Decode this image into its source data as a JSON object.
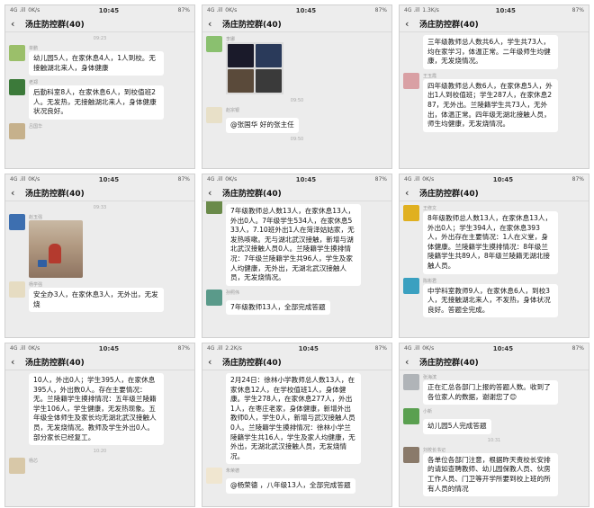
{
  "app": {
    "group_title": "汤庄防控群(40)"
  },
  "panels": [
    {
      "status": {
        "signal": "4G .ill",
        "speed": "0K/s",
        "time": "10:45",
        "battery": "87%"
      },
      "items": [
        {
          "kind": "ts",
          "text": "09:23"
        },
        {
          "kind": "msg",
          "sender": "单鹏",
          "avatar": "#9bbf6a",
          "text": "幼儿园5人，在家休息4人，1人到校。无接触湖北来人，身体健康"
        },
        {
          "kind": "msg",
          "sender": "老郑",
          "avatar": "#3c7a3a",
          "text": "后勤科室8人，在家休息6人，到校值班2人。无发热，无接触湖北来人，身体健康状况良好。"
        },
        {
          "kind": "msg",
          "sender": "吕国华",
          "avatar": "#c6b18c",
          "text": ""
        }
      ]
    },
    {
      "status": {
        "signal": "4G .ill",
        "speed": "0K/s",
        "time": "10:45",
        "battery": "87%"
      },
      "items": [
        {
          "kind": "img",
          "sender": "李娜",
          "avatar": "#8ac06f"
        },
        {
          "kind": "ts",
          "text": "09:50"
        },
        {
          "kind": "msg",
          "sender": "赵宗银",
          "avatar": "#e8e0c8",
          "text": "@张国华  好的张主任"
        },
        {
          "kind": "ts",
          "text": "09:50"
        }
      ]
    },
    {
      "status": {
        "signal": "4G .ill",
        "speed": "1.3K/s",
        "time": "10:45",
        "battery": "87%"
      },
      "items": [
        {
          "kind": "msg",
          "sender": "",
          "avatar": "",
          "text": "三年级教师总人数共6人，学生共73人，均在家学习，体温正常。二年级师生均健康，无发烧情况。",
          "clip": true
        },
        {
          "kind": "msg",
          "sender": "王玉霞",
          "avatar": "#d9a0a4",
          "text": "四年级教师总人数6人，在家休息5人，外出1人到校值班；学生287人，在家休息287，无外出。兰陵籍学生共73人，无外出，体温正常。四年级无湖北接触人员，师生均健康，无发烧情况。"
        }
      ]
    },
    {
      "status": {
        "signal": "4G .ill",
        "speed": "0K/s",
        "time": "10:45",
        "battery": "87%"
      },
      "items": [
        {
          "kind": "ts",
          "text": "09:33"
        },
        {
          "kind": "photo",
          "sender": "赵玉强",
          "avatar": "#3d6fb0"
        },
        {
          "kind": "msg",
          "sender": "杨学强",
          "avatar": "#e6dcc2",
          "text": "安全办3人，在家休息3人，无外出，无发烧"
        }
      ]
    },
    {
      "status": {
        "signal": "4G .ill",
        "speed": "0K/s",
        "time": "10:45",
        "battery": "87%"
      },
      "items": [
        {
          "kind": "msg",
          "sender": "",
          "avatar": "#6a8a4a",
          "text": "7年级教师总人数13人，在家休息13人，外出0人。7年级学生534人，在家休息533人，7.10班外出1人在菏泽姑姑家，无发热咳嗽。无与湖北武汉接触，新增与湖北武汉接触人员0人。兰陵籍学生摸排情况：7年级兰陵籍学生共96人，学生及家人均健康，无外出，无湖北武汉接触人员，无发烧情况。",
          "clip": true
        },
        {
          "kind": "msg",
          "sender": "孙照伟",
          "avatar": "#5a9a8a",
          "text": "7年级教师13人，全部完成答题"
        }
      ]
    },
    {
      "status": {
        "signal": "4G .ill",
        "speed": "0K/s",
        "time": "10:45",
        "battery": "87%"
      },
      "items": [
        {
          "kind": "msg",
          "sender": "王修文",
          "avatar": "#e0b020",
          "text": "8年级教师总人数13人，在家休息13人，外出0人；学生394人，在家休息393人，外出存在主要情况：1人在义堂，身体健康。兰陵籍学生摸排情况：8年级兰陵籍学生共89人，8年级兰陵籍无湖北接触人员。"
        },
        {
          "kind": "msg",
          "sender": "陈彬君",
          "avatar": "#3aa0c0",
          "text": "中学科室教师9人，在家休息6人，到校3人，无接触湖北来人，不发热，身体状况良好。答题全完成。"
        }
      ]
    },
    {
      "status": {
        "signal": "4G .ill",
        "speed": "0K/s",
        "time": "10:45",
        "battery": "87%"
      },
      "items": [
        {
          "kind": "msg",
          "sender": "",
          "avatar": "",
          "text": "10人，外出0人；学生395人，在家休息395人，外出数0人。存在主要情况：无。兰陵籍学生摸排情况：五年级兰陵籍学生106人，学生健康，无发热现象。五年级全体师生及家长均无湖北武汉接触人员，无发烧情况。教师及学生外出0人。部分家长已经复工。",
          "clip": true
        },
        {
          "kind": "ts",
          "text": "10:20"
        },
        {
          "kind": "msg",
          "sender": "杨芯",
          "avatar": "#d8c8a8",
          "text": ""
        }
      ]
    },
    {
      "status": {
        "signal": "4G .ill",
        "speed": "2.2K/s",
        "time": "10:45",
        "battery": "87%"
      },
      "items": [
        {
          "kind": "msg",
          "sender": "",
          "avatar": "",
          "text": "2月24日：徐林小学教师总人数13人，在家休息12人，在学校值班1人，身体健康。学生278人，在家休息277人，外出1人，在枣庄老家，身体健康，新增外出教师0人，学生0人，新增与武汉接触人员0人。兰陵籍学生摸排情况：徐林小学兰陵籍学生共16人，学生及家人均健康，无外出，无湖北武汉接触人员，无发烧情况。",
          "clip": true
        },
        {
          "kind": "msg",
          "sender": "朱荣德",
          "avatar": "#f0e6d0",
          "text": "@杨荣德 ，八年级13人，全部完成答题"
        }
      ]
    },
    {
      "status": {
        "signal": "4G .ill",
        "speed": "0K/s",
        "time": "10:45",
        "battery": "87%"
      },
      "items": [
        {
          "kind": "msg",
          "sender": "张海滨",
          "avatar": "#b0b4b8",
          "text": "正在汇总各部门上报的答题人数。收到了各位家人的数据，谢谢您了😊"
        },
        {
          "kind": "msg",
          "sender": "小新",
          "avatar": "#5aa050",
          "text": "幼儿园5人完成答题"
        },
        {
          "kind": "ts",
          "text": "10:31"
        },
        {
          "kind": "msg",
          "sender": "刘校长书记",
          "avatar": "#8a7a6a",
          "text": "各单位各部门注意，根据昨天责校长安排的请如查聘教师、幼儿园保教人员、伙房工作人员、门卫等开学所要到校上班的所有人员的情况"
        }
      ]
    }
  ]
}
